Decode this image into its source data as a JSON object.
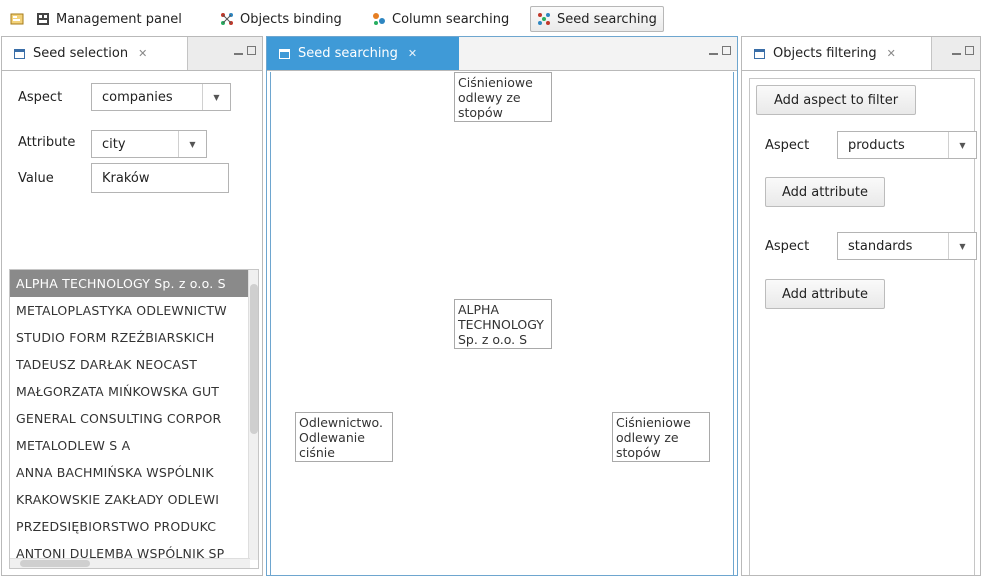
{
  "toolbar": {
    "items": [
      {
        "label": "",
        "icon": "panel-toggle-icon"
      },
      {
        "label": "Management panel",
        "icon": "management-panel-icon"
      },
      {
        "label": "Objects binding",
        "icon": "objects-binding-icon"
      },
      {
        "label": "Column searching",
        "icon": "column-searching-icon"
      },
      {
        "label": "Seed searching",
        "icon": "seed-searching-icon",
        "active": true
      }
    ]
  },
  "seed_selection": {
    "tab_label": "Seed selection",
    "aspect_label": "Aspect",
    "aspect_value": "companies",
    "attribute_label": "Attribute",
    "attribute_value": "city",
    "value_label": "Value",
    "value_value": "Kraków",
    "results": [
      "ALPHA TECHNOLOGY Sp. z o.o. S",
      "METALOPLASTYKA ODLEWNICTW",
      "STUDIO FORM RZEŹBIARSKICH",
      "TADEUSZ DARŁAK NEOCAST",
      "MAŁGORZATA MIŃKOWSKA GUT",
      "GENERAL CONSULTING CORPOR",
      "METALODLEW S A",
      "ANNA BACHMIŃSKA WSPÓLNIK",
      "KRAKOWSKIE ZAKŁADY ODLEWI",
      "PRZEDSIĘBIORSTWO PRODUKC",
      "ANTONI DULEMBA WSPÓLNIK SP"
    ],
    "selected_index": 0
  },
  "seed_searching": {
    "tab_label": "Seed searching",
    "nodes": [
      {
        "text": "Ciśnieniowe odlewy ze stopów"
      },
      {
        "text": "ALPHA TECHNOLOGY Sp. z o.o. S"
      },
      {
        "text": "Odlewnictwo. Odlewanie ciśnie"
      },
      {
        "text": "Ciśnieniowe odlewy ze stopów"
      }
    ]
  },
  "objects_filtering": {
    "tab_label": "Objects filtering",
    "add_aspect_label": "Add aspect to filter",
    "filters": [
      {
        "aspect_label": "Aspect",
        "aspect_value": "products",
        "add_attr_label": "Add attribute"
      },
      {
        "aspect_label": "Aspect",
        "aspect_value": "standards",
        "add_attr_label": "Add attribute"
      }
    ]
  },
  "colors": {
    "active_tab": "#3f9ad7",
    "selected_row": "#8a8a8a"
  }
}
